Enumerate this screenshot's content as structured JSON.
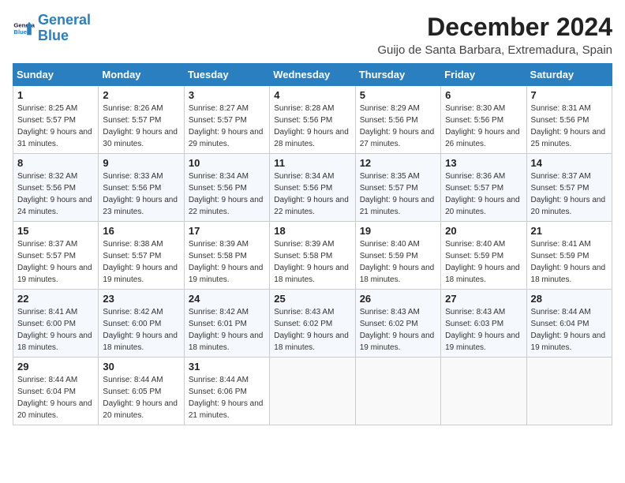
{
  "logo": {
    "line1": "General",
    "line2": "Blue"
  },
  "title": "December 2024",
  "subtitle": "Guijo de Santa Barbara, Extremadura, Spain",
  "weekdays": [
    "Sunday",
    "Monday",
    "Tuesday",
    "Wednesday",
    "Thursday",
    "Friday",
    "Saturday"
  ],
  "weeks": [
    [
      {
        "day": "1",
        "sunrise": "8:25 AM",
        "sunset": "5:57 PM",
        "daylight": "9 hours and 31 minutes."
      },
      {
        "day": "2",
        "sunrise": "8:26 AM",
        "sunset": "5:57 PM",
        "daylight": "9 hours and 30 minutes."
      },
      {
        "day": "3",
        "sunrise": "8:27 AM",
        "sunset": "5:57 PM",
        "daylight": "9 hours and 29 minutes."
      },
      {
        "day": "4",
        "sunrise": "8:28 AM",
        "sunset": "5:56 PM",
        "daylight": "9 hours and 28 minutes."
      },
      {
        "day": "5",
        "sunrise": "8:29 AM",
        "sunset": "5:56 PM",
        "daylight": "9 hours and 27 minutes."
      },
      {
        "day": "6",
        "sunrise": "8:30 AM",
        "sunset": "5:56 PM",
        "daylight": "9 hours and 26 minutes."
      },
      {
        "day": "7",
        "sunrise": "8:31 AM",
        "sunset": "5:56 PM",
        "daylight": "9 hours and 25 minutes."
      }
    ],
    [
      {
        "day": "8",
        "sunrise": "8:32 AM",
        "sunset": "5:56 PM",
        "daylight": "9 hours and 24 minutes."
      },
      {
        "day": "9",
        "sunrise": "8:33 AM",
        "sunset": "5:56 PM",
        "daylight": "9 hours and 23 minutes."
      },
      {
        "day": "10",
        "sunrise": "8:34 AM",
        "sunset": "5:56 PM",
        "daylight": "9 hours and 22 minutes."
      },
      {
        "day": "11",
        "sunrise": "8:34 AM",
        "sunset": "5:56 PM",
        "daylight": "9 hours and 22 minutes."
      },
      {
        "day": "12",
        "sunrise": "8:35 AM",
        "sunset": "5:57 PM",
        "daylight": "9 hours and 21 minutes."
      },
      {
        "day": "13",
        "sunrise": "8:36 AM",
        "sunset": "5:57 PM",
        "daylight": "9 hours and 20 minutes."
      },
      {
        "day": "14",
        "sunrise": "8:37 AM",
        "sunset": "5:57 PM",
        "daylight": "9 hours and 20 minutes."
      }
    ],
    [
      {
        "day": "15",
        "sunrise": "8:37 AM",
        "sunset": "5:57 PM",
        "daylight": "9 hours and 19 minutes."
      },
      {
        "day": "16",
        "sunrise": "8:38 AM",
        "sunset": "5:57 PM",
        "daylight": "9 hours and 19 minutes."
      },
      {
        "day": "17",
        "sunrise": "8:39 AM",
        "sunset": "5:58 PM",
        "daylight": "9 hours and 19 minutes."
      },
      {
        "day": "18",
        "sunrise": "8:39 AM",
        "sunset": "5:58 PM",
        "daylight": "9 hours and 18 minutes."
      },
      {
        "day": "19",
        "sunrise": "8:40 AM",
        "sunset": "5:59 PM",
        "daylight": "9 hours and 18 minutes."
      },
      {
        "day": "20",
        "sunrise": "8:40 AM",
        "sunset": "5:59 PM",
        "daylight": "9 hours and 18 minutes."
      },
      {
        "day": "21",
        "sunrise": "8:41 AM",
        "sunset": "5:59 PM",
        "daylight": "9 hours and 18 minutes."
      }
    ],
    [
      {
        "day": "22",
        "sunrise": "8:41 AM",
        "sunset": "6:00 PM",
        "daylight": "9 hours and 18 minutes."
      },
      {
        "day": "23",
        "sunrise": "8:42 AM",
        "sunset": "6:00 PM",
        "daylight": "9 hours and 18 minutes."
      },
      {
        "day": "24",
        "sunrise": "8:42 AM",
        "sunset": "6:01 PM",
        "daylight": "9 hours and 18 minutes."
      },
      {
        "day": "25",
        "sunrise": "8:43 AM",
        "sunset": "6:02 PM",
        "daylight": "9 hours and 18 minutes."
      },
      {
        "day": "26",
        "sunrise": "8:43 AM",
        "sunset": "6:02 PM",
        "daylight": "9 hours and 19 minutes."
      },
      {
        "day": "27",
        "sunrise": "8:43 AM",
        "sunset": "6:03 PM",
        "daylight": "9 hours and 19 minutes."
      },
      {
        "day": "28",
        "sunrise": "8:44 AM",
        "sunset": "6:04 PM",
        "daylight": "9 hours and 19 minutes."
      }
    ],
    [
      {
        "day": "29",
        "sunrise": "8:44 AM",
        "sunset": "6:04 PM",
        "daylight": "9 hours and 20 minutes."
      },
      {
        "day": "30",
        "sunrise": "8:44 AM",
        "sunset": "6:05 PM",
        "daylight": "9 hours and 20 minutes."
      },
      {
        "day": "31",
        "sunrise": "8:44 AM",
        "sunset": "6:06 PM",
        "daylight": "9 hours and 21 minutes."
      },
      null,
      null,
      null,
      null
    ]
  ],
  "labels": {
    "sunrise": "Sunrise:",
    "sunset": "Sunset:",
    "daylight": "Daylight:"
  }
}
